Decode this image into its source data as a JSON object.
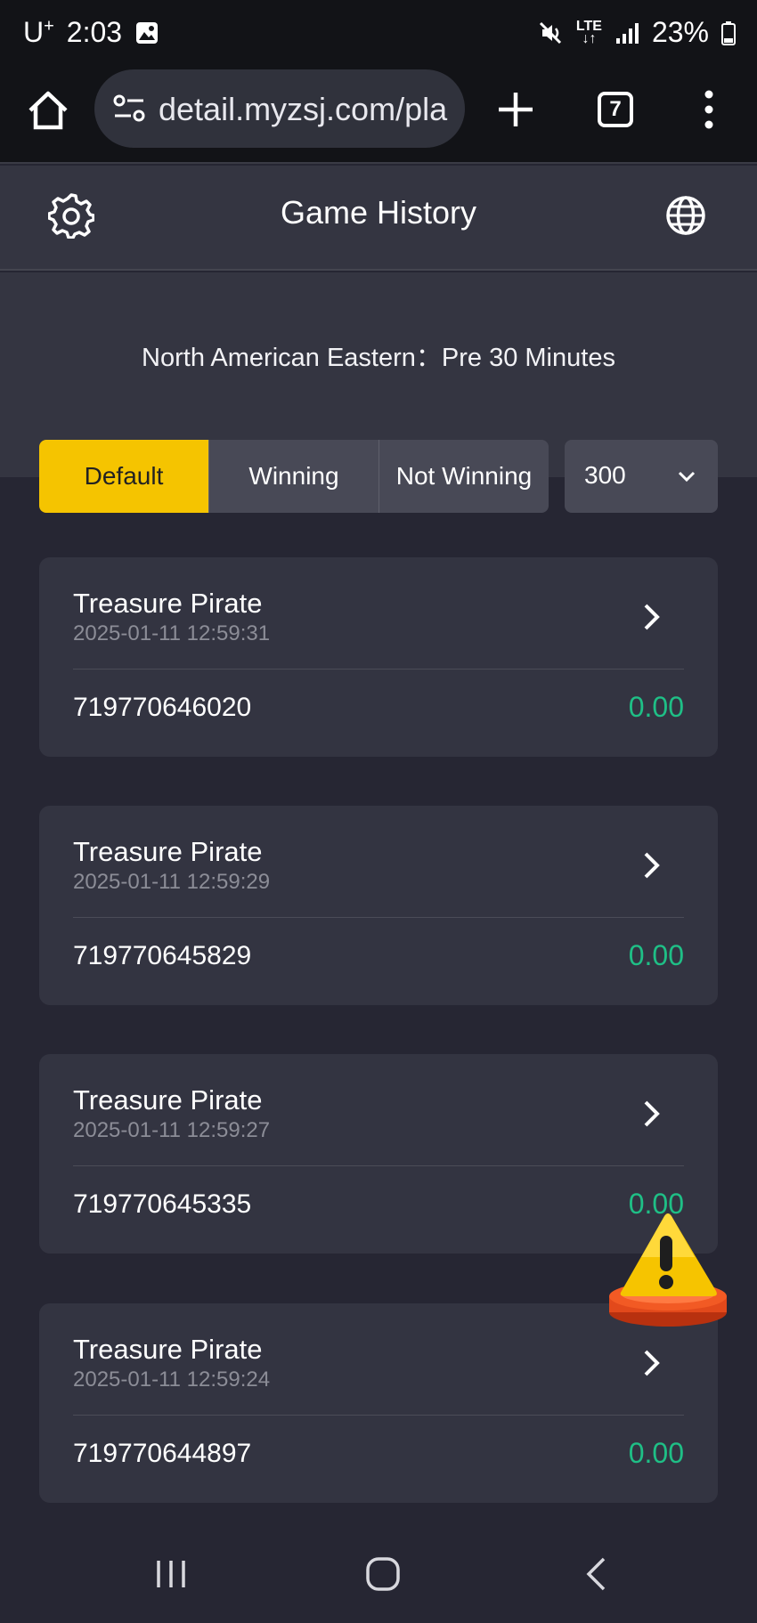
{
  "status_bar": {
    "carrier": "U",
    "carrier_sup": "+",
    "time": "2:03",
    "network": "LTE",
    "battery": "23%",
    "icons": [
      "image-icon",
      "mute-icon",
      "signal-icon",
      "battery-icon"
    ]
  },
  "browser": {
    "url": "detail.myzsj.com/pla",
    "tab_count": "7",
    "icons": [
      "home-icon",
      "site-settings-icon",
      "plus-icon",
      "tabs-icon",
      "more-vert-icon"
    ]
  },
  "header": {
    "title": "Game History",
    "icons": [
      "gear-icon",
      "globe-icon"
    ]
  },
  "timezone_label": "North American Eastern：Pre 30 Minutes",
  "filters": {
    "tabs": [
      {
        "label": "Default",
        "active": true
      },
      {
        "label": "Winning",
        "active": false
      },
      {
        "label": "Not Winning",
        "active": false
      }
    ],
    "count_selected": "300"
  },
  "records": [
    {
      "game": "Treasure Pirate",
      "time": "2025-01-11 12:59:31",
      "id": "719770646020",
      "amount": "0.00"
    },
    {
      "game": "Treasure Pirate",
      "time": "2025-01-11 12:59:29",
      "id": "719770645829",
      "amount": "0.00"
    },
    {
      "game": "Treasure Pirate",
      "time": "2025-01-11 12:59:27",
      "id": "719770645335",
      "amount": "0.00"
    },
    {
      "game": "Treasure Pirate",
      "time": "2025-01-11 12:59:24",
      "id": "719770644897",
      "amount": "0.00"
    }
  ],
  "colors": {
    "accent": "#f5c400",
    "amount": "#1fbf86",
    "background": "#262633",
    "card": "#333441"
  }
}
